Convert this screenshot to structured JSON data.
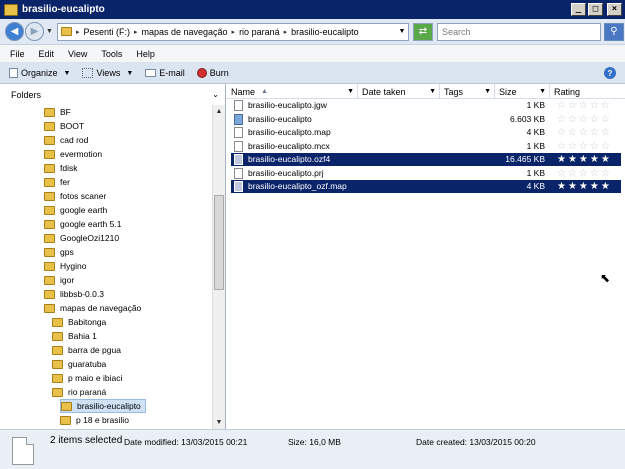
{
  "window": {
    "title": "brasilio-eucalipto"
  },
  "address": {
    "crumbs": [
      "Pesenti (F:)",
      "mapas de navegação",
      "rio paraná",
      "brasilio-eucalipto"
    ],
    "search_placeholder": "Search"
  },
  "menu": [
    "File",
    "Edit",
    "View",
    "Tools",
    "Help"
  ],
  "toolbar": {
    "organize": "Organize",
    "views": "Views",
    "email": "E-mail",
    "burn": "Burn"
  },
  "folders": {
    "header": "Folders",
    "items": [
      {
        "label": "BF",
        "level": 0
      },
      {
        "label": "BOOT",
        "level": 0
      },
      {
        "label": "cad rod",
        "level": 0
      },
      {
        "label": "evermotion",
        "level": 0
      },
      {
        "label": "fdisk",
        "level": 0
      },
      {
        "label": "fer",
        "level": 0
      },
      {
        "label": "fotos scaner",
        "level": 0
      },
      {
        "label": "google earth",
        "level": 0
      },
      {
        "label": "google earth 5.1",
        "level": 0
      },
      {
        "label": "GoogleOzi1210",
        "level": 0
      },
      {
        "label": "gps",
        "level": 0
      },
      {
        "label": "Hygino",
        "level": 0
      },
      {
        "label": "igor",
        "level": 0
      },
      {
        "label": "libbsb-0.0.3",
        "level": 0
      },
      {
        "label": "mapas de navegação",
        "level": 0
      },
      {
        "label": "Babitonga",
        "level": 1
      },
      {
        "label": "Bahia 1",
        "level": 1
      },
      {
        "label": "barra de pgua",
        "level": 1
      },
      {
        "label": "guaratuba",
        "level": 1
      },
      {
        "label": "p maio e ibiaci",
        "level": 1
      },
      {
        "label": "rio paraná",
        "level": 1
      },
      {
        "label": "brasilio-eucalipto",
        "level": 2,
        "selected": true
      },
      {
        "label": "p 18 e brasilio",
        "level": 2
      }
    ]
  },
  "columns": {
    "name": "Name",
    "date": "Date taken",
    "tags": "Tags",
    "size": "Size",
    "rating": "Rating"
  },
  "files": [
    {
      "name": "brasilio-eucalipto.jgw",
      "size": "1 KB",
      "selected": false,
      "rating": 0
    },
    {
      "name": "brasilio-eucalipto",
      "size": "6.603 KB",
      "selected": false,
      "rating": 0,
      "image": true
    },
    {
      "name": "brasilio-eucalipto.map",
      "size": "4 KB",
      "selected": false,
      "rating": 0
    },
    {
      "name": "brasilio-eucalipto.mcx",
      "size": "1 KB",
      "selected": false,
      "rating": 0
    },
    {
      "name": "brasilio-eucalipto.ozf4",
      "size": "16.465 KB",
      "selected": true,
      "rating": 5
    },
    {
      "name": "brasilio-eucalipto.prj",
      "size": "1 KB",
      "selected": false,
      "rating": 0
    },
    {
      "name": "brasilio-eucalipto_ozf.map",
      "size": "4 KB",
      "selected": true,
      "rating": 5
    }
  ],
  "status": {
    "count": "2 items selected",
    "modified": "Date modified: 13/03/2015 00:21",
    "size": "Size: 16,0 MB",
    "created": "Date created: 13/03/2015 00:20"
  },
  "colors": {
    "selection": "#0a246a",
    "titlebar": "#0a246a",
    "toolbar": "#dbe5f1"
  }
}
